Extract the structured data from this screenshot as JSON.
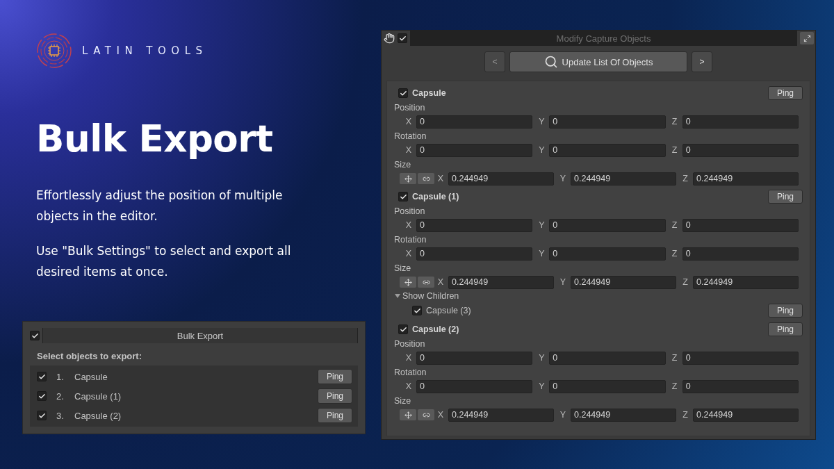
{
  "brand": {
    "name": "LATIN TOOLS"
  },
  "hero": {
    "title": "Bulk Export",
    "paragraphs": [
      "Effortlessly adjust the position of multiple objects in the editor.",
      "Use \"Bulk Settings\" to select and export all desired items at once."
    ]
  },
  "bulk_export": {
    "enabled": true,
    "title": "Bulk Export",
    "subtitle": "Select objects to export:",
    "items": [
      {
        "number": "1.",
        "name": "Capsule",
        "checked": true,
        "button": "Ping"
      },
      {
        "number": "2.",
        "name": "Capsule (1)",
        "checked": true,
        "button": "Ping"
      },
      {
        "number": "3.",
        "name": "Capsule (2)",
        "checked": true,
        "button": "Ping"
      }
    ]
  },
  "capture_panel": {
    "enabled": true,
    "title": "Modify Capture Objects",
    "prev": "<",
    "update_button": "Update List Of Objects",
    "next": ">",
    "objects": [
      {
        "name": "Capsule",
        "checked": true,
        "ping": "Ping",
        "groups": [
          {
            "kind": "vector",
            "label": "Position",
            "fields": [
              {
                "axis": "X",
                "value": "0"
              },
              {
                "axis": "Y",
                "value": "0"
              },
              {
                "axis": "Z",
                "value": "0"
              }
            ]
          },
          {
            "kind": "vector",
            "label": "Rotation",
            "fields": [
              {
                "axis": "X",
                "value": "0"
              },
              {
                "axis": "Y",
                "value": "0"
              },
              {
                "axis": "Z",
                "value": "0"
              }
            ]
          },
          {
            "kind": "scale",
            "label": "Size",
            "fields": [
              {
                "axis": "X",
                "value": "0.244949"
              },
              {
                "axis": "Y",
                "value": "0.244949"
              },
              {
                "axis": "Z",
                "value": "0.244949"
              }
            ]
          }
        ]
      },
      {
        "name": "Capsule (1)",
        "checked": true,
        "ping": "Ping",
        "groups": [
          {
            "kind": "vector",
            "label": "Position",
            "fields": [
              {
                "axis": "X",
                "value": "0"
              },
              {
                "axis": "Y",
                "value": "0"
              },
              {
                "axis": "Z",
                "value": "0"
              }
            ]
          },
          {
            "kind": "vector",
            "label": "Rotation",
            "fields": [
              {
                "axis": "X",
                "value": "0"
              },
              {
                "axis": "Y",
                "value": "0"
              },
              {
                "axis": "Z",
                "value": "0"
              }
            ]
          },
          {
            "kind": "scale",
            "label": "Size",
            "fields": [
              {
                "axis": "X",
                "value": "0.244949"
              },
              {
                "axis": "Y",
                "value": "0.244949"
              },
              {
                "axis": "Z",
                "value": "0.244949"
              }
            ]
          }
        ],
        "children": {
          "label": "Show Children",
          "expanded": true,
          "items": [
            {
              "name": "Capsule (3)",
              "checked": true,
              "ping": "Ping"
            }
          ]
        }
      },
      {
        "name": "Capsule (2)",
        "checked": true,
        "ping": "Ping",
        "groups": [
          {
            "kind": "vector",
            "label": "Position",
            "fields": [
              {
                "axis": "X",
                "value": "0"
              },
              {
                "axis": "Y",
                "value": "0"
              },
              {
                "axis": "Z",
                "value": "0"
              }
            ]
          },
          {
            "kind": "vector",
            "label": "Rotation",
            "fields": [
              {
                "axis": "X",
                "value": "0"
              },
              {
                "axis": "Y",
                "value": "0"
              },
              {
                "axis": "Z",
                "value": "0"
              }
            ]
          },
          {
            "kind": "scale",
            "label": "Size",
            "fields": [
              {
                "axis": "X",
                "value": "0.244949"
              },
              {
                "axis": "Y",
                "value": "0.244949"
              },
              {
                "axis": "Z",
                "value": "0.244949"
              }
            ]
          }
        ]
      }
    ]
  }
}
